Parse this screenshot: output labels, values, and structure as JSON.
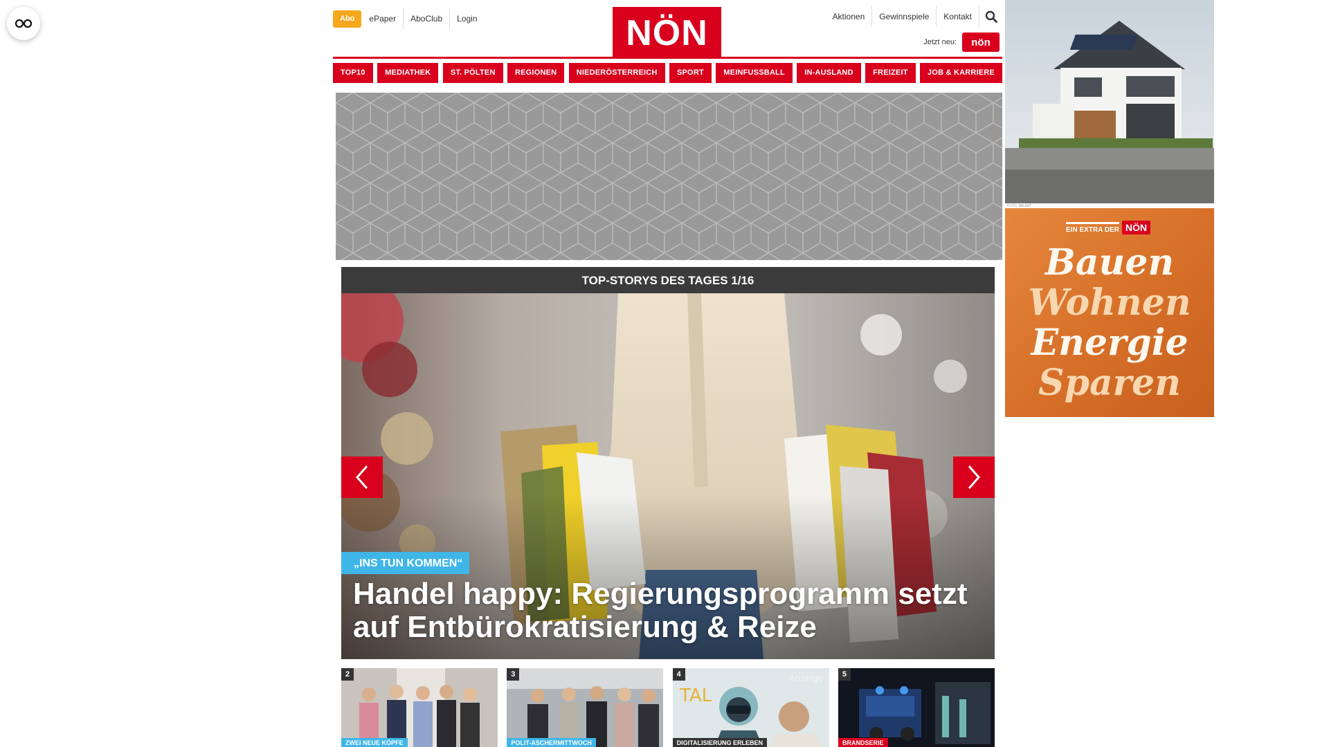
{
  "header": {
    "abo_label": "Abo",
    "left_links": [
      "ePaper",
      "AboClub",
      "Login"
    ],
    "logo_text": "NÖN",
    "right_links": [
      "Aktionen",
      "Gewinnspiele",
      "Kontakt"
    ],
    "jetzt_label": "Jetzt neu:",
    "jetzt_badge": "nön"
  },
  "nav": {
    "items": [
      "TOP10",
      "MEDIATHEK",
      "ST. PÖLTEN",
      "REGIONEN",
      "NIEDERÖSTERREICH",
      "SPORT",
      "MEINFUSSBALL",
      "IN-AUSLAND",
      "FREIZEIT",
      "JOB & KARRIERE"
    ]
  },
  "topstories": {
    "heading": "TOP-STORYS DES TAGES 1/16",
    "kicker": "„INS TUN KOMMEN“",
    "headline": "Handel happy: Regierungsprogramm setzt auf Entbürokratisierung & Reize"
  },
  "thumbs": [
    {
      "num": "2",
      "tag": "ZWEI NEUE KÖPFE",
      "tag_color": "#3fb6e8"
    },
    {
      "num": "3",
      "tag": "POLIT-ASCHERMITTWOCH",
      "tag_color": "#3fb6e8"
    },
    {
      "num": "4",
      "tag": "DIGITALISIERUNG ERLEBEN",
      "tag_color": "#333333",
      "anzeige": "Anzeige"
    },
    {
      "num": "5",
      "tag": "BRANDSERIE",
      "tag_color": "#d8001d"
    }
  ],
  "side_ads": {
    "photo_credit": "FOTO: BAUMIT",
    "extra_label": "EIN EXTRA DER",
    "extra_badge": "NÖN",
    "words": [
      "Bauen",
      "Wohnen",
      "Energie",
      "Sparen"
    ]
  },
  "colors": {
    "brand_red": "#d8001d",
    "abo_orange": "#f6a81c",
    "kicker_blue": "#3fb6e8",
    "ad_orange": "#d9732e"
  }
}
